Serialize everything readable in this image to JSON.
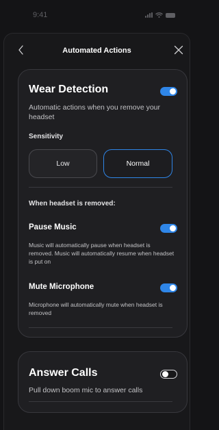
{
  "status_bar": {
    "time": "9:41"
  },
  "nav": {
    "title": "Automated Actions"
  },
  "wear_detection": {
    "title": "Wear Detection",
    "enabled": true,
    "description": "Automatic actions when you remove your headset",
    "sensitivity_label": "Sensitivity",
    "sensitivity_options": [
      "Low",
      "Normal"
    ],
    "sensitivity_selected": "Normal",
    "removed_heading": "When headset is removed:",
    "options": [
      {
        "title": "Pause Music",
        "enabled": true,
        "description": "Music will automatically pause when headset is removed. Music will automatically resume when headset is put on"
      },
      {
        "title": "Mute Microphone",
        "enabled": true,
        "description": "Microphone will automatically mute when headset is removed"
      }
    ]
  },
  "answer_calls": {
    "title": "Answer Calls",
    "enabled": false,
    "description": "Pull down boom mic to answer calls"
  },
  "colors": {
    "accent": "#2f86e8",
    "background": "#141416",
    "card": "#1f1f22"
  }
}
